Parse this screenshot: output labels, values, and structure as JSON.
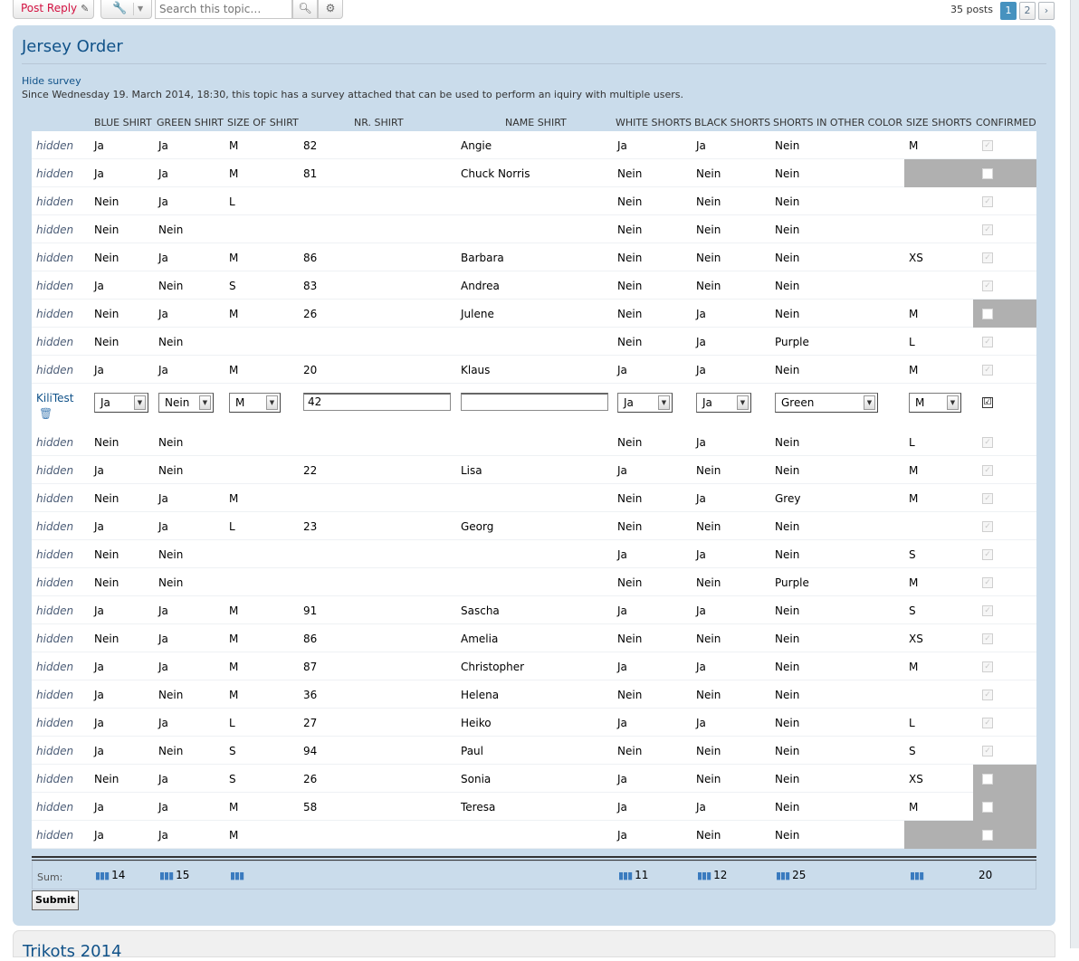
{
  "toolbar": {
    "post_reply": "Post Reply",
    "search_placeholder": "Search this topic…",
    "posts_count": "35 posts",
    "pages": [
      "1",
      "2"
    ],
    "next_page_icon": "chevron-right-icon"
  },
  "panel": {
    "title": "Jersey Order",
    "hide_survey": "Hide survey",
    "description": "Since Wednesday 19. March 2014, 18:30, this topic has a survey attached that can be used to perform an iquiry with multiple users."
  },
  "columns": [
    "BLUE SHIRT",
    "GREEN SHIRT",
    "SIZE OF SHIRT",
    "NR. SHIRT",
    "NAME SHIRT",
    "WHITE SHORTS",
    "BLACK SHORTS",
    "SHORTS IN OTHER COLOR",
    "SIZE SHORTS",
    "CONFIRMED"
  ],
  "rows_top": [
    {
      "user": "hidden",
      "blue": "Ja",
      "green": "Ja",
      "size": "M",
      "nr": "82",
      "name": "Angie",
      "white": "Ja",
      "black": "Ja",
      "other": "Nein",
      "ssize": "M",
      "confirmed": true,
      "grey": "none"
    },
    {
      "user": "hidden",
      "blue": "Ja",
      "green": "Ja",
      "size": "M",
      "nr": "81",
      "name": "Chuck Norris",
      "white": "Nein",
      "black": "Nein",
      "other": "Nein",
      "ssize": "",
      "confirmed": false,
      "grey": "wide"
    },
    {
      "user": "hidden",
      "blue": "Nein",
      "green": "Ja",
      "size": "L",
      "nr": "",
      "name": "",
      "white": "Nein",
      "black": "Nein",
      "other": "Nein",
      "ssize": "",
      "confirmed": true,
      "grey": "none"
    },
    {
      "user": "hidden",
      "blue": "Nein",
      "green": "Nein",
      "size": "",
      "nr": "",
      "name": "",
      "white": "Nein",
      "black": "Nein",
      "other": "Nein",
      "ssize": "",
      "confirmed": true,
      "grey": "none"
    },
    {
      "user": "hidden",
      "blue": "Nein",
      "green": "Ja",
      "size": "M",
      "nr": "86",
      "name": "Barbara",
      "white": "Nein",
      "black": "Nein",
      "other": "Nein",
      "ssize": "XS",
      "confirmed": true,
      "grey": "none"
    },
    {
      "user": "hidden",
      "blue": "Ja",
      "green": "Nein",
      "size": "S",
      "nr": "83",
      "name": "Andrea",
      "white": "Nein",
      "black": "Nein",
      "other": "Nein",
      "ssize": "",
      "confirmed": true,
      "grey": "none"
    },
    {
      "user": "hidden",
      "blue": "Nein",
      "green": "Ja",
      "size": "M",
      "nr": "26",
      "name": "Julene",
      "white": "Nein",
      "black": "Ja",
      "other": "Nein",
      "ssize": "M",
      "confirmed": false,
      "grey": "narrow"
    },
    {
      "user": "hidden",
      "blue": "Nein",
      "green": "Nein",
      "size": "",
      "nr": "",
      "name": "",
      "white": "Nein",
      "black": "Ja",
      "other": "Purple",
      "ssize": "L",
      "confirmed": true,
      "grey": "none"
    },
    {
      "user": "hidden",
      "blue": "Ja",
      "green": "Ja",
      "size": "M",
      "nr": "20",
      "name": "Klaus",
      "white": "Ja",
      "black": "Ja",
      "other": "Nein",
      "ssize": "M",
      "confirmed": true,
      "grey": "none"
    }
  ],
  "edit_row": {
    "user": "KiliTest",
    "blue": "Ja",
    "green": "Nein",
    "size": "M",
    "nr": "42",
    "name": "",
    "white": "Ja",
    "black": "Ja",
    "other": "Green",
    "ssize": "M",
    "confirmed": "☑",
    "trash_icon": "trash-icon"
  },
  "rows_bottom": [
    {
      "user": "hidden",
      "blue": "Nein",
      "green": "Nein",
      "size": "",
      "nr": "",
      "name": "",
      "white": "Nein",
      "black": "Ja",
      "other": "Nein",
      "ssize": "L",
      "confirmed": true,
      "grey": "none"
    },
    {
      "user": "hidden",
      "blue": "Ja",
      "green": "Nein",
      "size": "",
      "nr": "22",
      "name": "Lisa",
      "white": "Ja",
      "black": "Nein",
      "other": "Nein",
      "ssize": "M",
      "confirmed": true,
      "grey": "none"
    },
    {
      "user": "hidden",
      "blue": "Nein",
      "green": "Ja",
      "size": "M",
      "nr": "",
      "name": "",
      "white": "Nein",
      "black": "Ja",
      "other": "Grey",
      "ssize": "M",
      "confirmed": true,
      "grey": "none"
    },
    {
      "user": "hidden",
      "blue": "Ja",
      "green": "Ja",
      "size": "L",
      "nr": "23",
      "name": "Georg",
      "white": "Nein",
      "black": "Nein",
      "other": "Nein",
      "ssize": "",
      "confirmed": true,
      "grey": "none"
    },
    {
      "user": "hidden",
      "blue": "Nein",
      "green": "Nein",
      "size": "",
      "nr": "",
      "name": "",
      "white": "Ja",
      "black": "Ja",
      "other": "Nein",
      "ssize": "S",
      "confirmed": true,
      "grey": "none"
    },
    {
      "user": "hidden",
      "blue": "Nein",
      "green": "Nein",
      "size": "",
      "nr": "",
      "name": "",
      "white": "Nein",
      "black": "Nein",
      "other": "Purple",
      "ssize": "M",
      "confirmed": true,
      "grey": "none"
    },
    {
      "user": "hidden",
      "blue": "Ja",
      "green": "Ja",
      "size": "M",
      "nr": "91",
      "name": "Sascha",
      "white": "Ja",
      "black": "Ja",
      "other": "Nein",
      "ssize": "S",
      "confirmed": true,
      "grey": "none"
    },
    {
      "user": "hidden",
      "blue": "Nein",
      "green": "Ja",
      "size": "M",
      "nr": "86",
      "name": "Amelia",
      "white": "Nein",
      "black": "Nein",
      "other": "Nein",
      "ssize": "XS",
      "confirmed": true,
      "grey": "none"
    },
    {
      "user": "hidden",
      "blue": "Ja",
      "green": "Ja",
      "size": "M",
      "nr": "87",
      "name": "Christopher",
      "white": "Ja",
      "black": "Ja",
      "other": "Nein",
      "ssize": "M",
      "confirmed": true,
      "grey": "none"
    },
    {
      "user": "hidden",
      "blue": "Ja",
      "green": "Nein",
      "size": "M",
      "nr": "36",
      "name": "Helena",
      "white": "Nein",
      "black": "Nein",
      "other": "Nein",
      "ssize": "",
      "confirmed": true,
      "grey": "none"
    },
    {
      "user": "hidden",
      "blue": "Ja",
      "green": "Ja",
      "size": "L",
      "nr": "27",
      "name": "Heiko",
      "white": "Ja",
      "black": "Ja",
      "other": "Nein",
      "ssize": "L",
      "confirmed": true,
      "grey": "none"
    },
    {
      "user": "hidden",
      "blue": "Ja",
      "green": "Nein",
      "size": "S",
      "nr": "94",
      "name": "Paul",
      "white": "Nein",
      "black": "Nein",
      "other": "Nein",
      "ssize": "S",
      "confirmed": true,
      "grey": "none"
    },
    {
      "user": "hidden",
      "blue": "Nein",
      "green": "Ja",
      "size": "S",
      "nr": "26",
      "name": "Sonia",
      "white": "Ja",
      "black": "Nein",
      "other": "Nein",
      "ssize": "XS",
      "confirmed": false,
      "grey": "narrow"
    },
    {
      "user": "hidden",
      "blue": "Ja",
      "green": "Ja",
      "size": "M",
      "nr": "58",
      "name": "Teresa",
      "white": "Ja",
      "black": "Ja",
      "other": "Nein",
      "ssize": "M",
      "confirmed": false,
      "grey": "narrow"
    },
    {
      "user": "hidden",
      "blue": "Ja",
      "green": "Ja",
      "size": "M",
      "nr": "",
      "name": "",
      "white": "Ja",
      "black": "Nein",
      "other": "Nein",
      "ssize": "",
      "confirmed": false,
      "grey": "wide"
    }
  ],
  "sum": {
    "label": "Sum:",
    "blue": "14",
    "green": "15",
    "size": "",
    "white": "11",
    "black": "12",
    "other": "25",
    "ssize": "",
    "confirmed": "20"
  },
  "submit_label": "Submit",
  "next_topic_title": "Trikots 2014",
  "colors": {
    "panel_bg": "#cadceb",
    "title": "#105289",
    "grey_cell": "#b0b0b0",
    "post_reply": "#d31141"
  }
}
